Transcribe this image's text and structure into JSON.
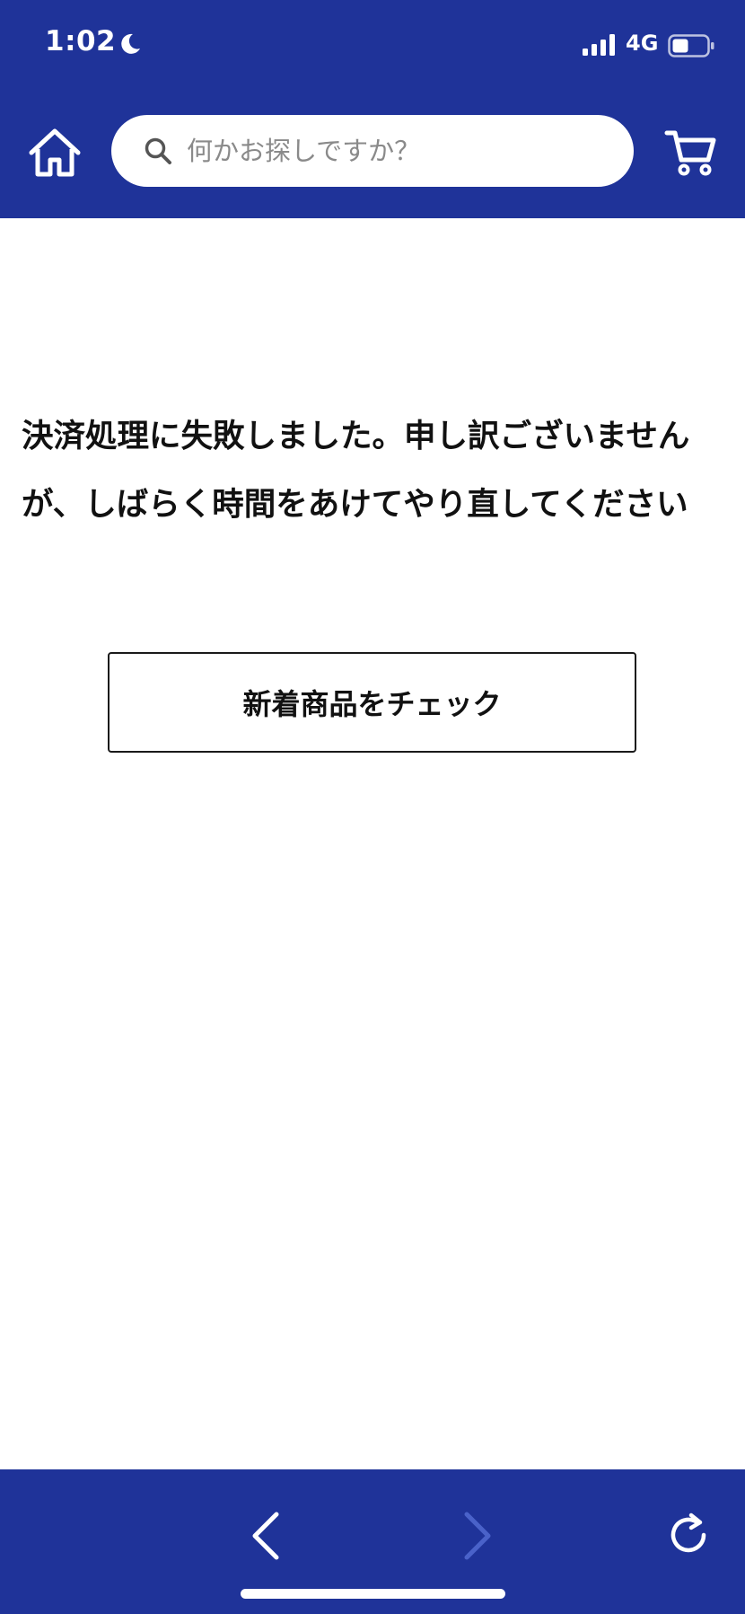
{
  "status_bar": {
    "time": "1:02",
    "network": "4G",
    "icons": [
      "moon-icon",
      "signal-icon",
      "battery-icon"
    ]
  },
  "header": {
    "home_icon": "home-icon",
    "search": {
      "placeholder": "何かお探しですか？",
      "value": "",
      "icon": "search-icon"
    },
    "cart_icon": "cart-icon"
  },
  "main": {
    "error_message": "決済処理に失敗しました。申し訳ございませんが、しばらく時間をあけてやり直してください",
    "new_items_button_label": "新着商品をチェック"
  },
  "bottom_toolbar": {
    "icons": [
      "back-icon",
      "forward-icon",
      "reload-icon"
    ],
    "forward_enabled": false
  },
  "colors": {
    "brand_blue": "#1f3399",
    "text": "#111111",
    "placeholder": "#8a8a8a",
    "disabled_icon": "#4a62c9"
  }
}
